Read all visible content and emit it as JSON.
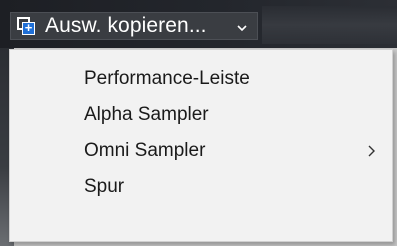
{
  "toolbar": {
    "copy_button_label": "Ausw. kopieren...",
    "copy_icon": "copy-add-icon",
    "caret_icon": "chevron-down-icon"
  },
  "menu": {
    "items": [
      {
        "label": "Performance-Leiste",
        "has_submenu": false
      },
      {
        "label": "Alpha Sampler",
        "has_submenu": false
      },
      {
        "label": "Omni Sampler",
        "has_submenu": true,
        "submenu_icon": "chevron-right-icon"
      },
      {
        "label": "Spur",
        "has_submenu": false
      }
    ]
  },
  "colors": {
    "toolbar_bg": "#23262c",
    "menu_bg": "#f2f2f2",
    "icon_accent": "#1f6fd6",
    "menu_text": "#1a1a1a"
  }
}
